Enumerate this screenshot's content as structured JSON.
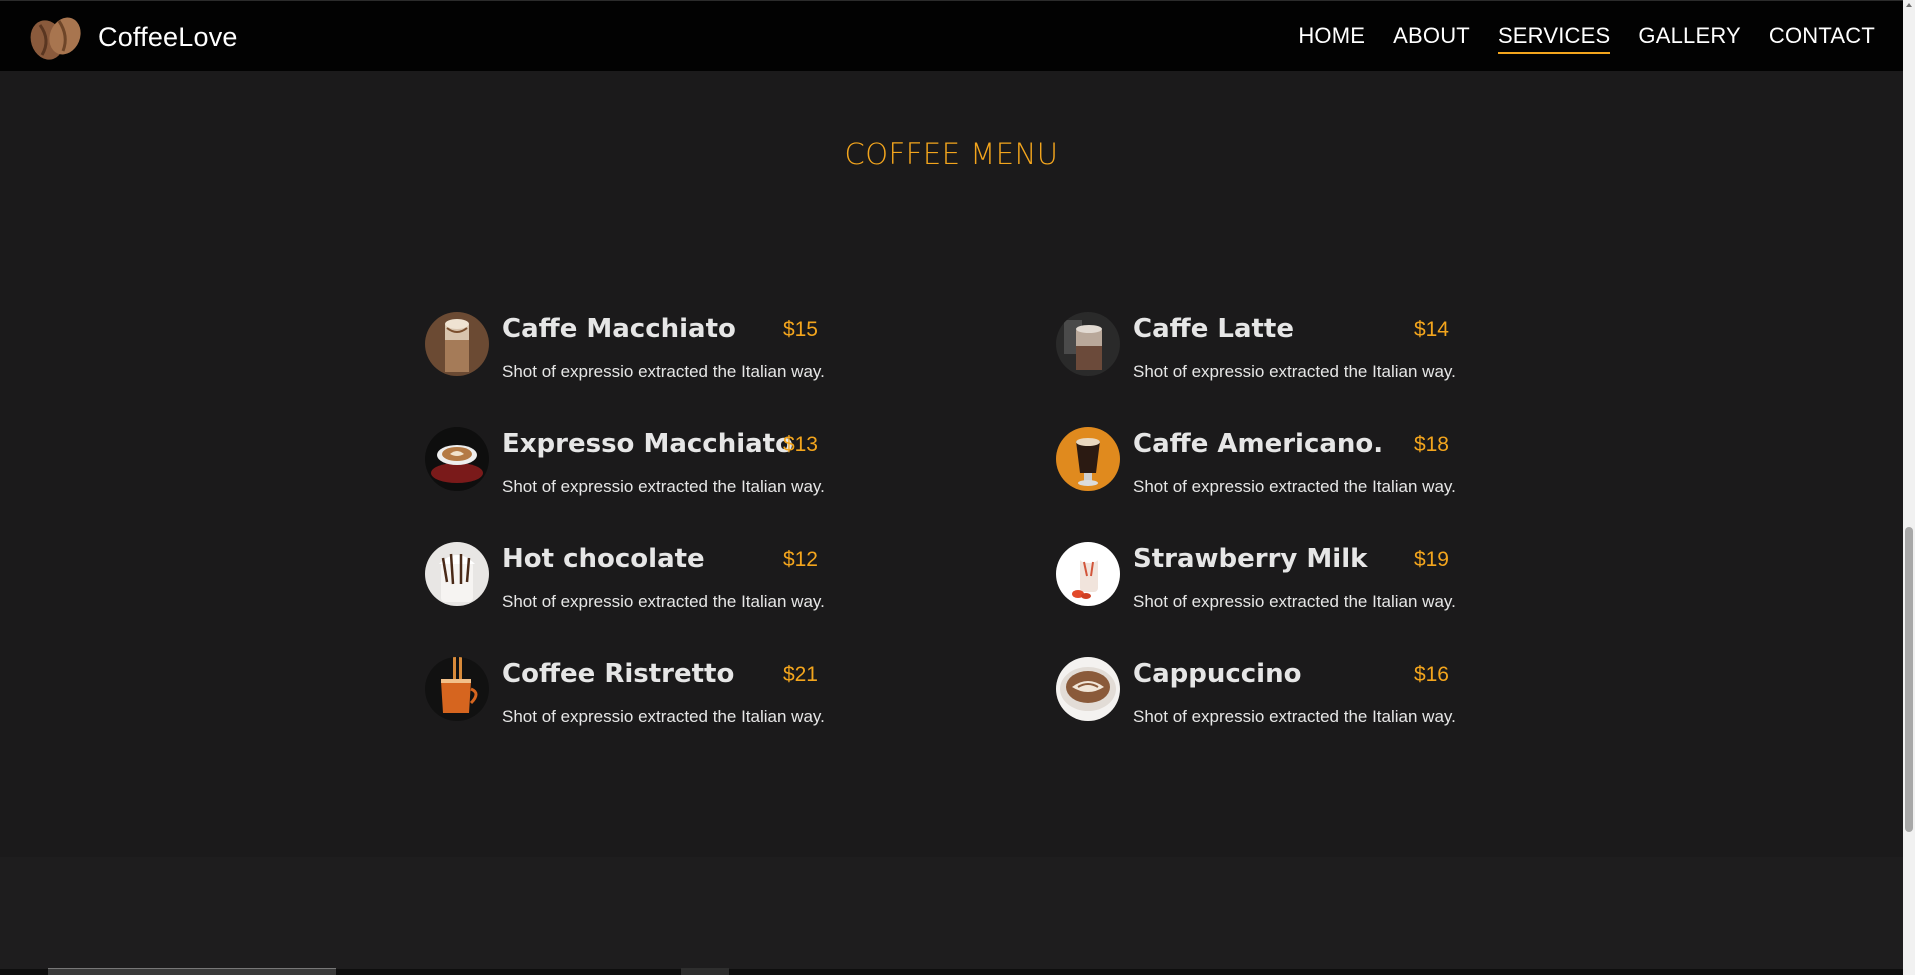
{
  "header": {
    "brand": "CoffeeLove",
    "nav": [
      {
        "label": "HOME"
      },
      {
        "label": "ABOUT"
      },
      {
        "label": "SERVICES"
      },
      {
        "label": "GALLERY"
      },
      {
        "label": "CONTACT"
      }
    ],
    "active_nav": "SERVICES"
  },
  "menu": {
    "title": "COFFEE MENU",
    "items": [
      {
        "name": "Caffe Macchiato",
        "price": "$15",
        "description": "Shot of expressio extracted the Italian way.",
        "image": "caffe-macchiato-image"
      },
      {
        "name": "Caffe Latte",
        "price": "$14",
        "description": "Shot of expressio extracted the Italian way.",
        "image": "caffe-latte-image"
      },
      {
        "name": "Expresso Macchiato",
        "price": "$13",
        "description": "Shot of expressio extracted the Italian way.",
        "image": "expresso-macchiato-image"
      },
      {
        "name": "Caffe Americano.",
        "price": "$18",
        "description": "Shot of expressio extracted the Italian way.",
        "image": "caffe-americano-image"
      },
      {
        "name": "Hot chocolate",
        "price": "$12",
        "description": "Shot of expressio extracted the Italian way.",
        "image": "hot-chocolate-image"
      },
      {
        "name": "Strawberry Milk",
        "price": "$19",
        "description": "Shot of expressio extracted the Italian way.",
        "image": "strawberry-milk-image"
      },
      {
        "name": "Coffee Ristretto",
        "price": "$21",
        "description": "Shot of expressio extracted the Italian way.",
        "image": "coffee-ristretto-image"
      },
      {
        "name": "Cappuccino",
        "price": "$16",
        "description": "Shot of expressio extracted the Italian way.",
        "image": "cappuccino-image"
      }
    ]
  },
  "colors": {
    "accent": "#f3a51d",
    "background": "#1b1a1b",
    "navbar": "#020202",
    "text": "#e6e6e6"
  }
}
